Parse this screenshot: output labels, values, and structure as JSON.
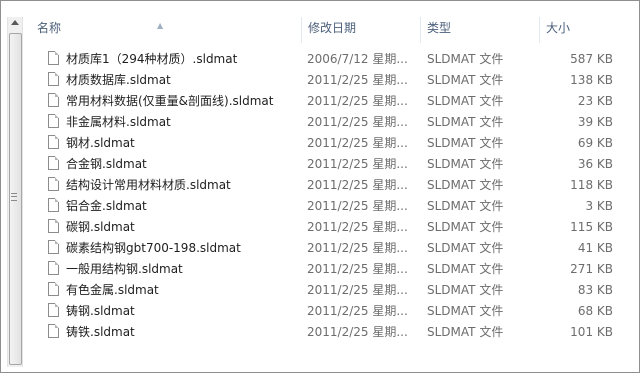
{
  "columns": {
    "name": "名称",
    "date": "修改日期",
    "type": "类型",
    "size": "大小"
  },
  "files": [
    {
      "name": "材质库1（294种材质）.sldmat",
      "date": "2006/7/12 星期...",
      "type": "SLDMAT 文件",
      "size": "587 KB"
    },
    {
      "name": "材质数据库.sldmat",
      "date": "2011/2/25 星期...",
      "type": "SLDMAT 文件",
      "size": "138 KB"
    },
    {
      "name": "常用材料数据(仅重量&剖面线).sldmat",
      "date": "2011/2/25 星期...",
      "type": "SLDMAT 文件",
      "size": "23 KB"
    },
    {
      "name": "非金属材料.sldmat",
      "date": "2011/2/25 星期...",
      "type": "SLDMAT 文件",
      "size": "39 KB"
    },
    {
      "name": "钢材.sldmat",
      "date": "2011/2/25 星期...",
      "type": "SLDMAT 文件",
      "size": "69 KB"
    },
    {
      "name": "合金钢.sldmat",
      "date": "2011/2/25 星期...",
      "type": "SLDMAT 文件",
      "size": "36 KB"
    },
    {
      "name": "结构设计常用材料材质.sldmat",
      "date": "2011/2/25 星期...",
      "type": "SLDMAT 文件",
      "size": "118 KB"
    },
    {
      "name": "铝合金.sldmat",
      "date": "2011/2/25 星期...",
      "type": "SLDMAT 文件",
      "size": "3 KB"
    },
    {
      "name": "碳钢.sldmat",
      "date": "2011/2/25 星期...",
      "type": "SLDMAT 文件",
      "size": "115 KB"
    },
    {
      "name": "碳素结构钢gbt700-198.sldmat",
      "date": "2011/2/25 星期...",
      "type": "SLDMAT 文件",
      "size": "41 KB"
    },
    {
      "name": "一般用结构钢.sldmat",
      "date": "2011/2/25 星期...",
      "type": "SLDMAT 文件",
      "size": "271 KB"
    },
    {
      "name": "有色金属.sldmat",
      "date": "2011/2/25 星期...",
      "type": "SLDMAT 文件",
      "size": "83 KB"
    },
    {
      "name": "铸钢.sldmat",
      "date": "2011/2/25 星期...",
      "type": "SLDMAT 文件",
      "size": "68 KB"
    },
    {
      "name": "铸铁.sldmat",
      "date": "2011/2/25 星期...",
      "type": "SLDMAT 文件",
      "size": "101 KB"
    }
  ]
}
